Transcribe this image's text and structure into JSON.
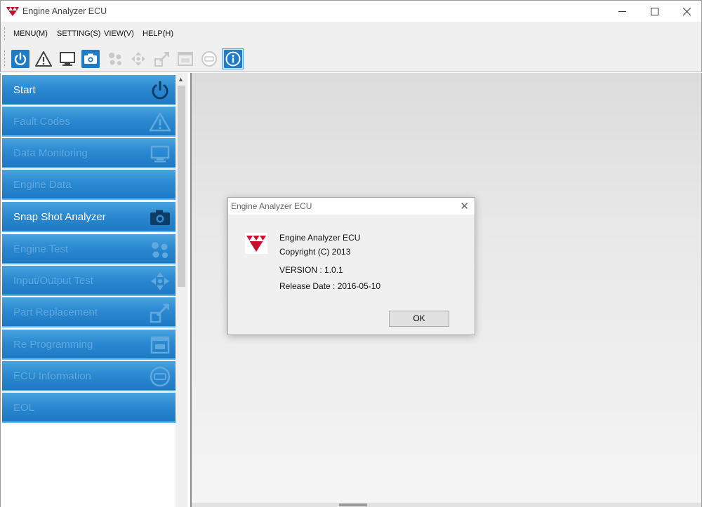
{
  "window": {
    "title": "Engine Analyzer ECU",
    "logo_icon": "massey-triangles-icon",
    "brand_color": "#c8102e"
  },
  "menubar": {
    "items": [
      {
        "label": "MENU(M)"
      },
      {
        "label": "SETTING(S)"
      },
      {
        "label": "VIEW(V)"
      },
      {
        "label": "HELP(H)"
      }
    ]
  },
  "toolbar": {
    "buttons": [
      {
        "icon": "power-icon",
        "enabled": true
      },
      {
        "icon": "warning-icon",
        "enabled": true
      },
      {
        "icon": "monitor-icon",
        "enabled": true
      },
      {
        "icon": "camera-icon",
        "enabled": true
      },
      {
        "icon": "engine-test-icon",
        "enabled": false
      },
      {
        "icon": "io-arrows-icon",
        "enabled": false
      },
      {
        "icon": "part-replace-icon",
        "enabled": false
      },
      {
        "icon": "reprogram-icon",
        "enabled": false
      },
      {
        "icon": "ecu-info-icon",
        "enabled": false
      },
      {
        "icon": "info-icon",
        "enabled": true,
        "active": true
      }
    ]
  },
  "sidebar": {
    "items": [
      {
        "label": "Start",
        "icon": "power-icon",
        "enabled": true
      },
      {
        "label": "Fault Codes",
        "icon": "warning-icon",
        "enabled": false
      },
      {
        "label": "Data Monitoring",
        "icon": "monitor-icon",
        "enabled": false
      },
      {
        "label": "Engine Data",
        "icon": "none",
        "enabled": false
      },
      {
        "label": "Snap Shot Analyzer",
        "icon": "camera-icon",
        "enabled": true
      },
      {
        "label": "Engine Test",
        "icon": "engine-test-icon",
        "enabled": false
      },
      {
        "label": "Input/Output Test",
        "icon": "io-arrows-icon",
        "enabled": false
      },
      {
        "label": "Part Replacement",
        "icon": "part-replace-icon",
        "enabled": false
      },
      {
        "label": "Re Programming",
        "icon": "reprogram-icon",
        "enabled": false
      },
      {
        "label": "ECU Information",
        "icon": "ecu-info-icon",
        "enabled": false
      },
      {
        "label": "EOL",
        "icon": "none",
        "enabled": false
      }
    ]
  },
  "dialog": {
    "title": "Engine Analyzer ECU",
    "lines": [
      "Engine Analyzer ECU",
      "Copyright (C) 2013",
      "VERSION : 1.0.1",
      "Release Date : 2016-05-10"
    ],
    "ok_label": "OK"
  },
  "colors": {
    "nav_blue": "#2b8ad2",
    "disabled_text": "#5fa9de",
    "active_toolbar": "#cde4f7"
  }
}
